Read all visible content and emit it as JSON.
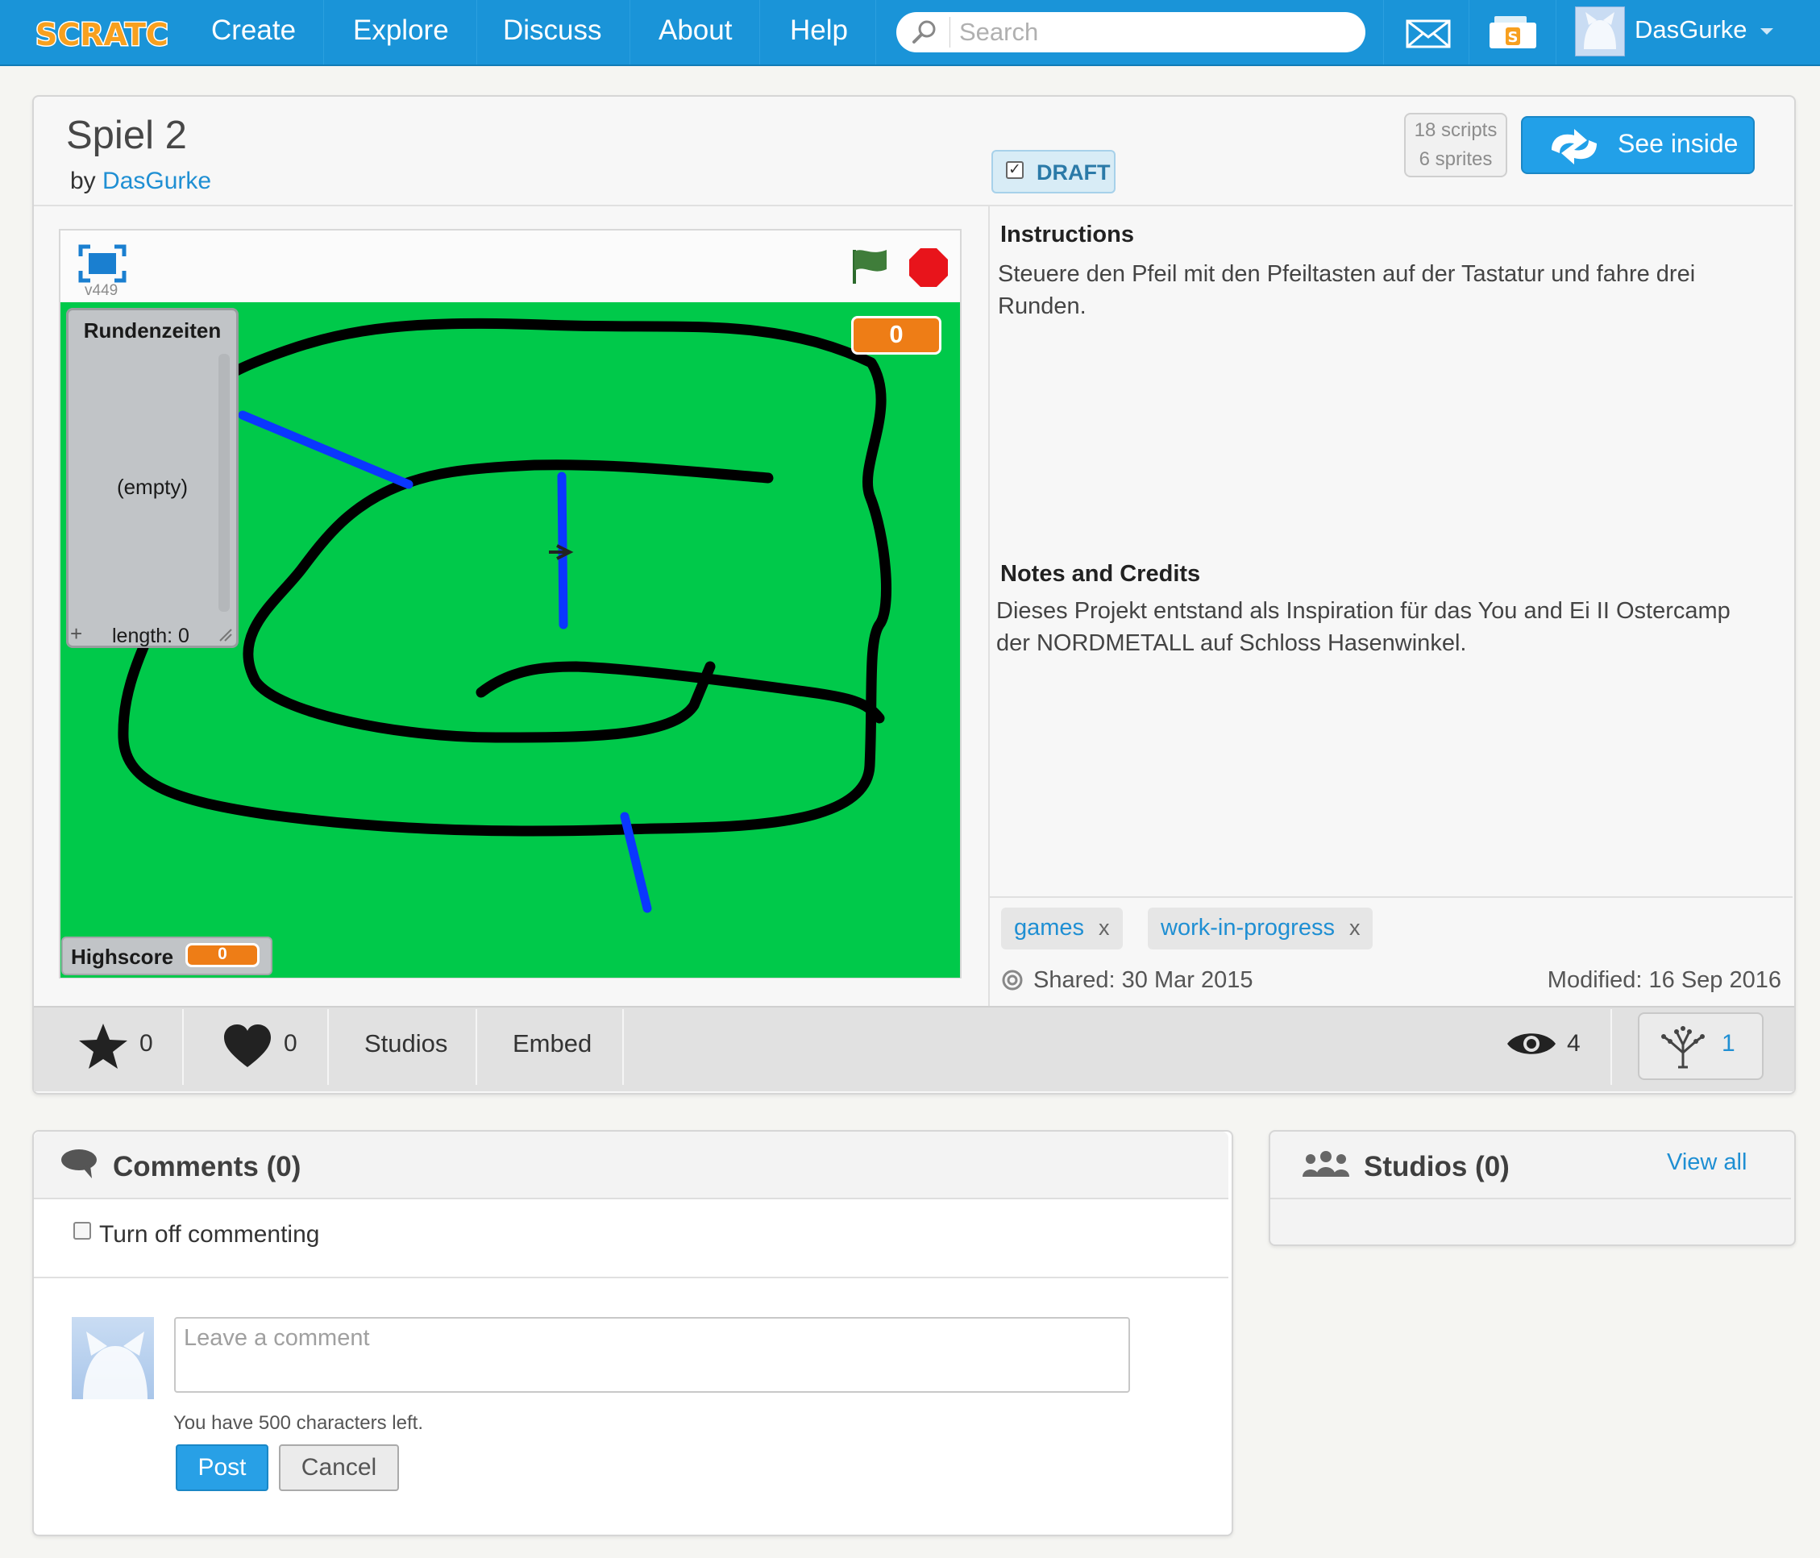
{
  "nav": {
    "logo_text": "SCRATCH",
    "links": [
      "Create",
      "Explore",
      "Discuss",
      "About",
      "Help"
    ],
    "search_placeholder": "Search",
    "username": "DasGurke"
  },
  "project": {
    "title": "Spiel 2",
    "by_label": "by",
    "author": "DasGurke",
    "draft_label": "DRAFT",
    "scripts_count": "18 scripts",
    "sprites_count": "6 sprites",
    "see_inside_label": "See inside"
  },
  "player": {
    "version": "v449",
    "list_monitor": {
      "title": "Rundenzeiten",
      "empty_text": "(empty)",
      "plus": "+",
      "length_text": "length: 0"
    },
    "score_value": "0",
    "highscore": {
      "label": "Highscore",
      "value": "0"
    }
  },
  "info": {
    "instructions_title": "Instructions",
    "instructions_text": "Steuere den Pfeil mit den Pfeiltasten auf der Tastatur und fahre drei Runden.",
    "notes_title": "Notes and Credits",
    "notes_text": "Dieses Projekt entstand als Inspiration für das You and Ei II Ostercamp der NORDMETALL auf Schloss Hasenwinkel.",
    "tags": [
      {
        "label": "games",
        "remove": "x"
      },
      {
        "label": "work-in-progress",
        "remove": "x"
      }
    ],
    "shared": "Shared: 30 Mar 2015",
    "modified": "Modified: 16 Sep 2016"
  },
  "stats": {
    "favorites": "0",
    "loves": "0",
    "studios_label": "Studios",
    "embed_label": "Embed",
    "views": "4",
    "remixes": "1"
  },
  "comments": {
    "title": "Comments (0)",
    "turn_off_label": "Turn off commenting",
    "placeholder": "Leave a comment",
    "chars_left": "You have 500 characters left.",
    "post_label": "Post",
    "cancel_label": "Cancel"
  },
  "studios": {
    "title": "Studios (0)",
    "view_all": "View all"
  },
  "colors": {
    "nav_blue": "#1a94d8",
    "link_blue": "#1f8fd3",
    "stage_green": "#00c94a",
    "variable_orange": "#ee7d16",
    "stop_red": "#e8141b"
  }
}
